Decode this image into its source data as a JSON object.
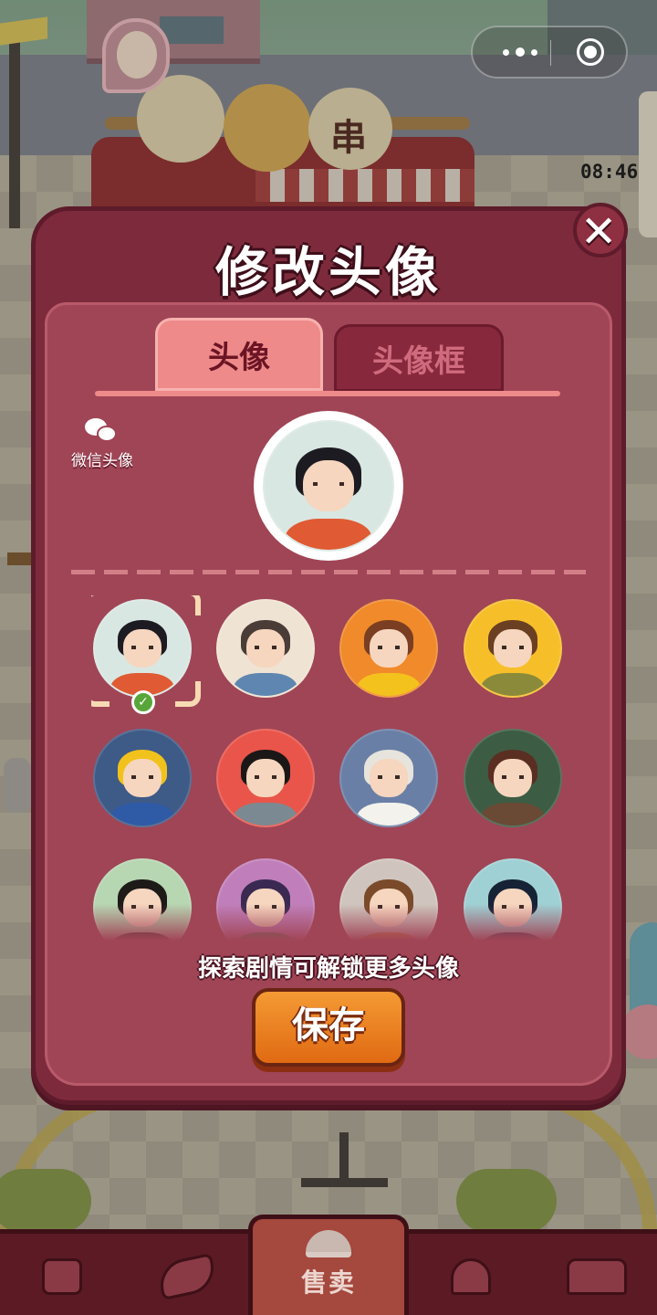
{
  "background": {
    "clock": "08:46",
    "cart_glyph": "串"
  },
  "capsule": {
    "more_icon": "more-dots-icon",
    "close_icon": "target-close-icon"
  },
  "modal": {
    "title": "修改头像",
    "close_icon": "close-icon",
    "tabs": [
      {
        "label": "头像",
        "active": true
      },
      {
        "label": "头像框",
        "active": false
      }
    ],
    "wechat_avatar_label": "微信头像",
    "hint": "探索剧情可解锁更多头像",
    "save_label": "保存",
    "selected_index": 0
  },
  "avatars": [
    {
      "bg": "#d9e7e2",
      "hair": "#1d1b22",
      "body": "#e05a33"
    },
    {
      "bg": "#efe3d3",
      "hair": "#4a3c36",
      "body": "#5e86b0"
    },
    {
      "bg": "#f08a2a",
      "hair": "#7a3e22",
      "body": "#f4c21d"
    },
    {
      "bg": "#f6bf2a",
      "hair": "#6a3f22",
      "body": "#8a8a3a"
    },
    {
      "bg": "#3e5a86",
      "hair": "#f2c21c",
      "body": "#2f5aa6"
    },
    {
      "bg": "#e9554a",
      "hair": "#1c1717",
      "body": "#7b8a92"
    },
    {
      "bg": "#6a7fa6",
      "hair": "#e6e4dc",
      "body": "#f4f2ec"
    },
    {
      "bg": "#3d5c44",
      "hair": "#5a2f22",
      "body": "#6a4a34"
    },
    {
      "bg": "#b7d6b2",
      "hair": "#1d1a18",
      "body": "#2b2a2a"
    },
    {
      "bg": "#c07fba",
      "hair": "#3a2a52",
      "body": "#4b7a5a"
    },
    {
      "bg": "#cfc5be",
      "hair": "#7a4a2a",
      "body": "#d08a3a"
    },
    {
      "bg": "#9fd0d4",
      "hair": "#162236",
      "body": "#233047"
    }
  ],
  "bottom_nav": [
    {
      "key": "bag",
      "icon": "shopping-bag-icon"
    },
    {
      "key": "handshake",
      "icon": "handshake-icon"
    },
    {
      "key": "sell",
      "icon": "service-bell-icon",
      "label": "售卖"
    },
    {
      "key": "map",
      "icon": "map-pin-icon"
    },
    {
      "key": "bus",
      "icon": "bus-icon"
    }
  ]
}
